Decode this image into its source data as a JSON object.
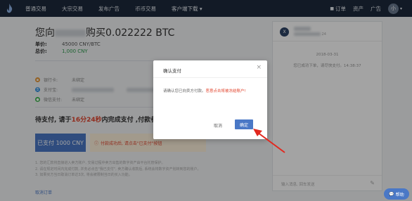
{
  "nav": {
    "items": [
      "普通交易",
      "大宗交易",
      "发布广告",
      "币币交易",
      "客户端下载"
    ],
    "right": {
      "orders": "订单",
      "assets": "资产",
      "ads": "广告",
      "avatar": "小"
    }
  },
  "order": {
    "title_prefix": "您向",
    "title_suffix": "购买0.022222 BTC",
    "price_label": "单价:",
    "price_value": "45000 CNY/BTC",
    "total_label": "总价:",
    "total_value": "1,000 CNY"
  },
  "payments": [
    {
      "label": "银行卡:",
      "value": "未绑定"
    },
    {
      "label": "支付宝:",
      "value": "",
      "copy": ""
    },
    {
      "label": "微信支付:",
      "value": "未绑定"
    }
  ],
  "countdown": {
    "prefix": "待支付,  请于",
    "time": "16分24秒",
    "suffix": "内完成支付 ,付款参考号"
  },
  "buttons": {
    "paid": "已支付 1000 CNY",
    "warning": "付款成功后, 请点击\"已支付\"按钮"
  },
  "notes": [
    "1. 您的汇款将直接进入卖方账户, 交易过程中卖方出售的数字资产由平台托管保护。",
    "2. 请在规定时间内完成付款, 并务必点击\"我已支付\", 卖方确认收款后, 系统会将数字资产划转到您的账户。",
    "3. 如果买方当日取消订单达3次, 将会被限制当日的买入功能。"
  ],
  "cancel_order": "取消订单",
  "chat": {
    "avatar": "X",
    "sub_suffix": "24",
    "date": "2018-03-31",
    "message": "您已成功下单，请尽快支付。14:38:37",
    "input_placeholder": "输入消息, 回车发送"
  },
  "modal": {
    "title": "确认支付",
    "body_plain": "请确认您已向卖方付款。",
    "body_warning": "恶意点击将被冻结账户!",
    "cancel": "取消",
    "confirm": "确定"
  },
  "help": "帮助"
}
